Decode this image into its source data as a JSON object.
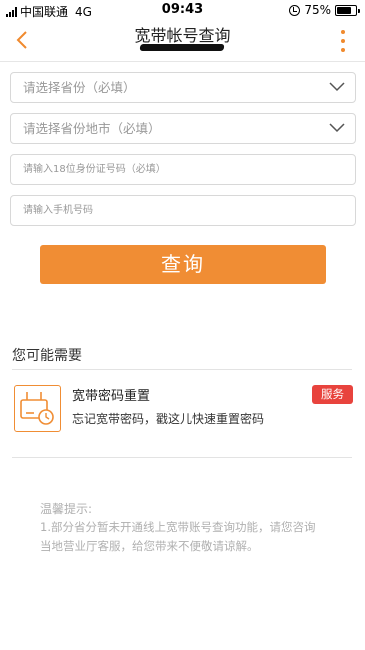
{
  "status_bar": {
    "carrier": "中国联通",
    "network": "4G",
    "time": "09:43",
    "battery": "75%",
    "battery_level": 0.75
  },
  "nav": {
    "title": "宽带帐号查询",
    "back_icon": "chevron-left-icon",
    "more_icon": "more-vertical-icon",
    "accent_color": "#f08a2e"
  },
  "form": {
    "province_placeholder": "请选择省份（必填）",
    "city_placeholder": "请选择省份地市（必填）",
    "id_placeholder": "请输入18位身份证号码（必填）",
    "phone_placeholder": "请输入手机号码",
    "submit_label": "查询",
    "button_color": "#f08d34"
  },
  "suggestions": {
    "title": "您可能需要",
    "items": [
      {
        "name": "宽带密码重置",
        "description": "忘记宽带密码，戳这儿快速重置密码",
        "badge": "服务",
        "icon": "router-reset-icon",
        "badge_color": "#e8433d"
      }
    ]
  },
  "tips": {
    "title": "温馨提示:",
    "text": "1.部分省分暂未开通线上宽带账号查询功能，请您咨询当地营业厅客服，给您带来不便敬请谅解。"
  }
}
